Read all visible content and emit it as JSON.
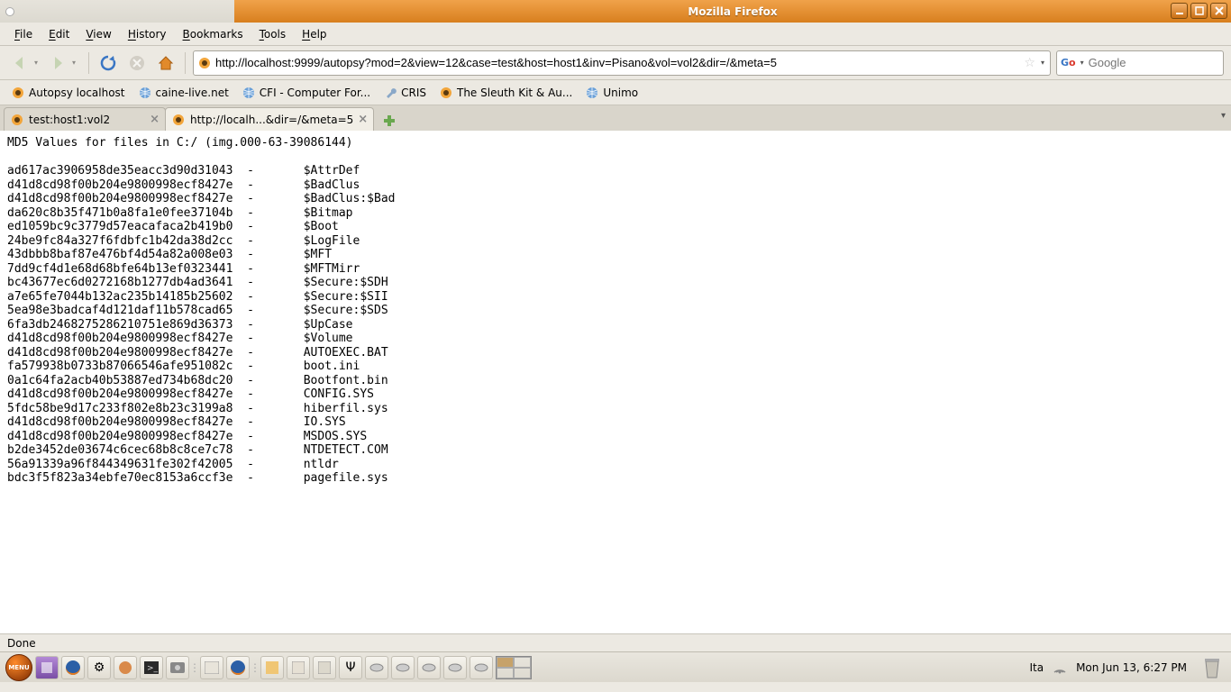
{
  "window": {
    "title": "Mozilla Firefox"
  },
  "menus": [
    "File",
    "Edit",
    "View",
    "History",
    "Bookmarks",
    "Tools",
    "Help"
  ],
  "url": "http://localhost:9999/autopsy?mod=2&view=12&case=test&host=host1&inv=Pisano&vol=vol2&dir=/&meta=5",
  "search": {
    "placeholder": "Google"
  },
  "bookmarks": [
    {
      "label": "Autopsy localhost",
      "icon": "autopsy"
    },
    {
      "label": "caine-live.net",
      "icon": "globe"
    },
    {
      "label": "CFI - Computer For...",
      "icon": "globe"
    },
    {
      "label": "CRIS",
      "icon": "wrench"
    },
    {
      "label": "The Sleuth Kit & Au...",
      "icon": "autopsy"
    },
    {
      "label": "Unimo",
      "icon": "globe"
    }
  ],
  "tabs": [
    {
      "label": "test:host1:vol2",
      "active": false
    },
    {
      "label": "http://localh...&dir=/&meta=5",
      "active": true
    }
  ],
  "page": {
    "header": "MD5 Values for files in C:/ (img.000-63-39086144)",
    "rows": [
      {
        "md5": "ad617ac3906958de35eacc3d90d31043",
        "dash": "-",
        "name": "$AttrDef"
      },
      {
        "md5": "d41d8cd98f00b204e9800998ecf8427e",
        "dash": "-",
        "name": "$BadClus"
      },
      {
        "md5": "d41d8cd98f00b204e9800998ecf8427e",
        "dash": "-",
        "name": "$BadClus:$Bad"
      },
      {
        "md5": "da620c8b35f471b0a8fa1e0fee37104b",
        "dash": "-",
        "name": "$Bitmap"
      },
      {
        "md5": "ed1059bc9c3779d57eacafaca2b419b0",
        "dash": "-",
        "name": "$Boot"
      },
      {
        "md5": "24be9fc84a327f6fdbfc1b42da38d2cc",
        "dash": "-",
        "name": "$LogFile"
      },
      {
        "md5": "43dbbb8baf87e476bf4d54a82a008e03",
        "dash": "-",
        "name": "$MFT"
      },
      {
        "md5": "7dd9cf4d1e68d68bfe64b13ef0323441",
        "dash": "-",
        "name": "$MFTMirr"
      },
      {
        "md5": "bc43677ec6d0272168b1277db4ad3641",
        "dash": "-",
        "name": "$Secure:$SDH"
      },
      {
        "md5": "a7e65fe7044b132ac235b14185b25602",
        "dash": "-",
        "name": "$Secure:$SII"
      },
      {
        "md5": "5ea98e3badcaf4d121daf11b578cad65",
        "dash": "-",
        "name": "$Secure:$SDS"
      },
      {
        "md5": "6fa3db2468275286210751e869d36373",
        "dash": "-",
        "name": "$UpCase"
      },
      {
        "md5": "d41d8cd98f00b204e9800998ecf8427e",
        "dash": "-",
        "name": "$Volume"
      },
      {
        "md5": "d41d8cd98f00b204e9800998ecf8427e",
        "dash": "-",
        "name": "AUTOEXEC.BAT"
      },
      {
        "md5": "fa579938b0733b87066546afe951082c",
        "dash": "-",
        "name": "boot.ini"
      },
      {
        "md5": "0a1c64fa2acb40b53887ed734b68dc20",
        "dash": "-",
        "name": "Bootfont.bin"
      },
      {
        "md5": "d41d8cd98f00b204e9800998ecf8427e",
        "dash": "-",
        "name": "CONFIG.SYS"
      },
      {
        "md5": "5fdc58be9d17c233f802e8b23c3199a8",
        "dash": "-",
        "name": "hiberfil.sys"
      },
      {
        "md5": "d41d8cd98f00b204e9800998ecf8427e",
        "dash": "-",
        "name": "IO.SYS"
      },
      {
        "md5": "d41d8cd98f00b204e9800998ecf8427e",
        "dash": "-",
        "name": "MSDOS.SYS"
      },
      {
        "md5": "b2de3452de03674c6cec68b8c8ce7c78",
        "dash": "-",
        "name": "NTDETECT.COM"
      },
      {
        "md5": "56a91339a96f844349631fe302f42005",
        "dash": "-",
        "name": "ntldr"
      },
      {
        "md5": "bdc3f5f823a34ebfe70ec8153a6ccf3e",
        "dash": "-",
        "name": "pagefile.sys"
      }
    ]
  },
  "status": "Done",
  "tray": {
    "lang": "Ita",
    "datetime": "Mon Jun 13,  6:27 PM"
  }
}
